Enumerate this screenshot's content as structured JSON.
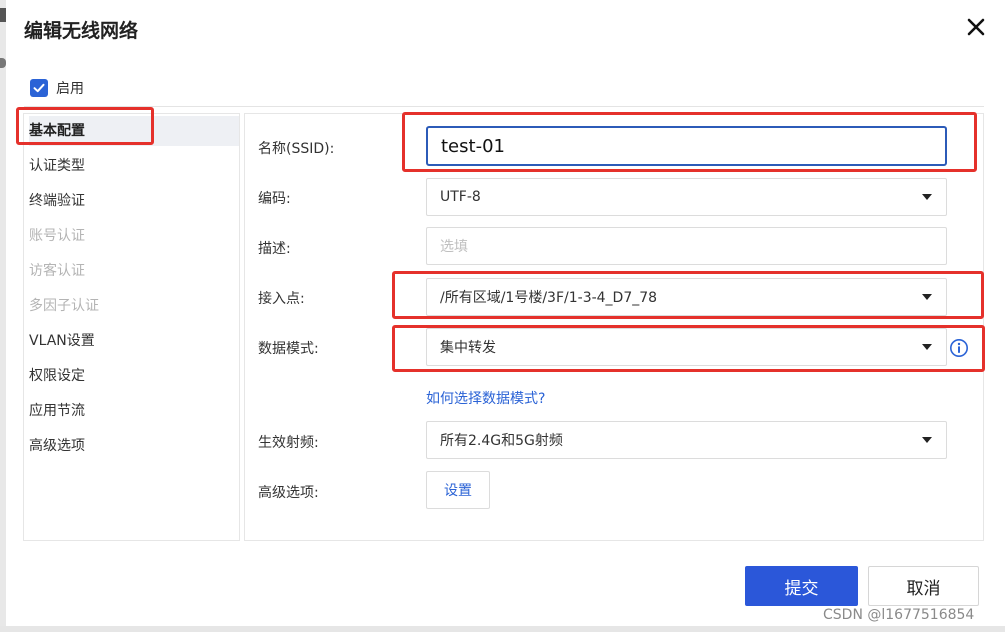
{
  "dialog": {
    "title": "编辑无线网络",
    "enable_label": "启用",
    "enabled": true
  },
  "sidebar": {
    "items": [
      {
        "label": "基本配置",
        "state": "active"
      },
      {
        "label": "认证类型",
        "state": "normal"
      },
      {
        "label": "终端验证",
        "state": "normal"
      },
      {
        "label": "账号认证",
        "state": "disabled"
      },
      {
        "label": "访客认证",
        "state": "disabled"
      },
      {
        "label": "多因子认证",
        "state": "disabled"
      },
      {
        "label": "VLAN设置",
        "state": "normal"
      },
      {
        "label": "权限设定",
        "state": "normal"
      },
      {
        "label": "应用节流",
        "state": "normal"
      },
      {
        "label": "高级选项",
        "state": "normal"
      }
    ]
  },
  "form": {
    "ssid": {
      "label": "名称(SSID):",
      "value": "test-01"
    },
    "encoding": {
      "label": "编码:",
      "value": "UTF-8"
    },
    "description": {
      "label": "描述:",
      "placeholder": "选填"
    },
    "access_point": {
      "label": "接入点:",
      "value": "/所有区域/1号楼/3F/1-3-4_D7_78"
    },
    "data_mode": {
      "label": "数据模式:",
      "value": "集中转发",
      "help_link": "如何选择数据模式?"
    },
    "radio": {
      "label": "生效射频:",
      "value": "所有2.4G和5G射频"
    },
    "advanced": {
      "label": "高级选项:",
      "button": "设置"
    }
  },
  "footer": {
    "submit": "提交",
    "cancel": "取消"
  },
  "watermark": "CSDN @l1677516854",
  "colors": {
    "primary": "#2b57d9",
    "link": "#2b63d6",
    "annotation": "#e5312b",
    "focus_border": "#2c5bb8"
  }
}
